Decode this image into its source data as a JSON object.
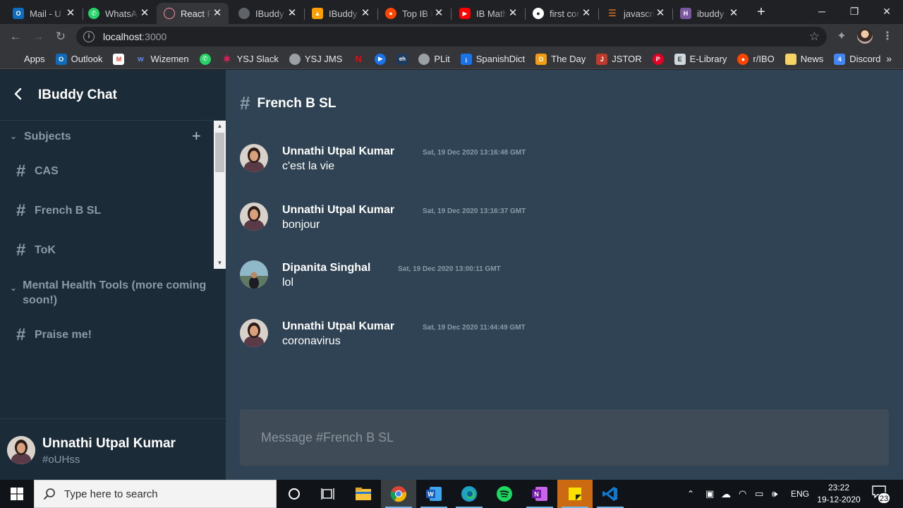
{
  "browser": {
    "tabs": [
      {
        "title": "Mail - U",
        "icon": "outlook-icon",
        "color": "#0f6cbd"
      },
      {
        "title": "WhatsA",
        "icon": "whatsapp-icon",
        "color": "#25d366"
      },
      {
        "title": "React R",
        "icon": "react-icon",
        "color": "#ff6b6b",
        "active": true
      },
      {
        "title": "IBuddy",
        "icon": "globe-icon",
        "color": "#9aa0a6"
      },
      {
        "title": "IBuddy",
        "icon": "firebase-icon",
        "color": "#ffa000"
      },
      {
        "title": "Top IB F",
        "icon": "reddit-icon",
        "color": "#ff4500"
      },
      {
        "title": "IB Math",
        "icon": "youtube-icon",
        "color": "#ff0000"
      },
      {
        "title": "first cor",
        "icon": "github-icon",
        "color": "#ffffff"
      },
      {
        "title": "javascri",
        "icon": "stackoverflow-icon",
        "color": "#f48024"
      },
      {
        "title": "ibuddy",
        "icon": "heroku-icon",
        "color": "#79589f"
      }
    ],
    "url_host": "localhost",
    "url_port": ":3000",
    "bookmarks": [
      {
        "label": "Apps",
        "icon": "apps-grid-icon",
        "color": "#ea4335"
      },
      {
        "label": "Outlook",
        "icon": "outlook-icon",
        "color": "#0f6cbd"
      },
      {
        "label": "",
        "icon": "gmail-icon",
        "color": "#ea4335"
      },
      {
        "label": "Wizemen",
        "icon": "wizemen-icon",
        "color": "#5a8dee"
      },
      {
        "label": "",
        "icon": "whatsapp-icon",
        "color": "#25d366"
      },
      {
        "label": "YSJ Slack",
        "icon": "slack-icon",
        "color": "#611f69"
      },
      {
        "label": "YSJ JMS",
        "icon": "globe-icon",
        "color": "#9aa0a6"
      },
      {
        "label": "",
        "icon": "netflix-icon",
        "color": "#e50914"
      },
      {
        "label": "",
        "icon": "play-icon",
        "color": "#1a73e8"
      },
      {
        "label": "",
        "icon": "eh-icon",
        "color": "#1f3a5f"
      },
      {
        "label": "PLit",
        "icon": "globe-icon",
        "color": "#9aa0a6"
      },
      {
        "label": "SpanishDict",
        "icon": "spanishdict-icon",
        "color": "#1a73e8"
      },
      {
        "label": "The Day",
        "icon": "theday-icon",
        "color": "#f39c12"
      },
      {
        "label": "JSTOR",
        "icon": "jstor-icon",
        "color": "#c0392b"
      },
      {
        "label": "",
        "icon": "pinterest-icon",
        "color": "#e60023"
      },
      {
        "label": "E-Library",
        "icon": "elibrary-icon",
        "color": "#cfd8dc"
      },
      {
        "label": "r/IBO",
        "icon": "reddit-icon",
        "color": "#ff4500"
      },
      {
        "label": "News",
        "icon": "folder-icon",
        "color": "#f6d365"
      },
      {
        "label": "Discord",
        "icon": "calendar-icon",
        "color": "#4285f4"
      }
    ]
  },
  "sidebar": {
    "title": "IBuddy Chat",
    "categories": [
      {
        "label": "Subjects",
        "channels": [
          "CAS",
          "French B SL",
          "ToK"
        ]
      },
      {
        "label": "Mental Health Tools (more coming soon!)",
        "channels": [
          "Praise me!"
        ]
      }
    ],
    "user": {
      "name": "Unnathi Utpal Kumar",
      "tag": "#oUHss"
    }
  },
  "chat": {
    "channel_name": "French B SL",
    "messages": [
      {
        "author": "Unnathi Utpal Kumar",
        "timestamp": "Sat, 19 Dec 2020 13:16:48 GMT",
        "text": "c'est la vie"
      },
      {
        "author": "Unnathi Utpal Kumar",
        "timestamp": "Sat, 19 Dec 2020 13:16:37 GMT",
        "text": "bonjour"
      },
      {
        "author": "Dipanita Singhal",
        "timestamp": "Sat, 19 Dec 2020 13:00:11 GMT",
        "text": "lol"
      },
      {
        "author": "Unnathi Utpal Kumar",
        "timestamp": "Sat, 19 Dec 2020 11:44:49 GMT",
        "text": "coronavirus"
      }
    ],
    "input_placeholder": "Message #French B SL"
  },
  "taskbar": {
    "search_placeholder": "Type here to search",
    "language": "ENG",
    "time": "23:22",
    "date": "19-12-2020",
    "notification_count": "23"
  },
  "colors": {
    "sidebar_bg": "#1b2b37",
    "main_bg": "#2f4354",
    "composer_bg": "#3f4c58",
    "muted_text": "#8a9ba8"
  }
}
